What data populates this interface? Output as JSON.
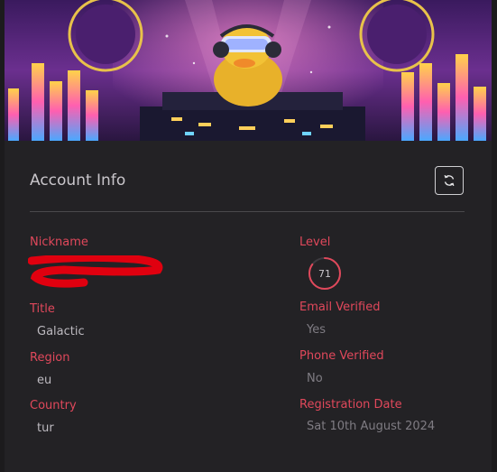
{
  "account": {
    "title": "Account Info",
    "refresh_icon": "refresh-icon",
    "nickname_label": "Nickname",
    "nickname_value": "",
    "title_label": "Title",
    "title_value": "Galactic",
    "region_label": "Region",
    "region_value": "eu",
    "country_label": "Country",
    "country_value": "tur",
    "level_label": "Level",
    "level_value": "71",
    "level_progress": 0.85,
    "email_label": "Email Verified",
    "email_value": "Yes",
    "phone_label": "Phone Verified",
    "phone_value": "No",
    "registration_label": "Registration Date",
    "registration_value": "Sat 10th August 2024"
  },
  "colors": {
    "accent": "#e0485b",
    "panel": "#232225",
    "redaction": "#e0000f"
  }
}
